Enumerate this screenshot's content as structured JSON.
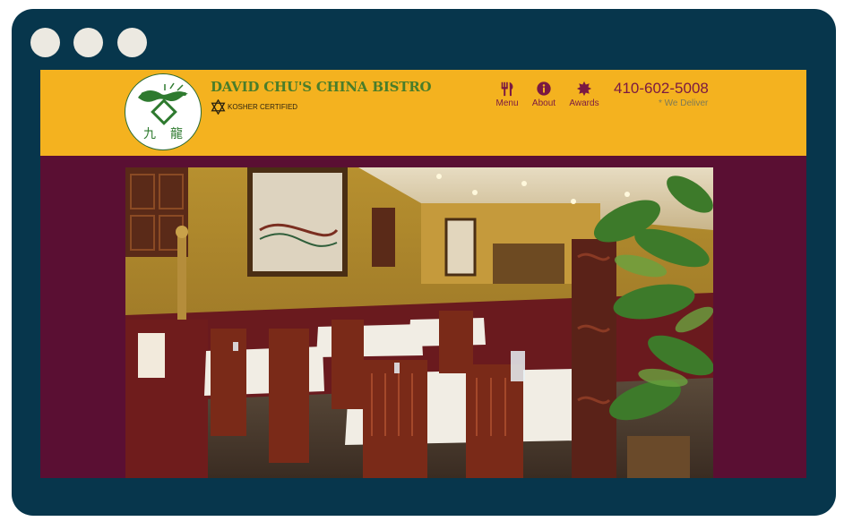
{
  "browser": {
    "controls": [
      "window-dot",
      "window-dot",
      "window-dot"
    ]
  },
  "header": {
    "brand_name": "DAVID CHU'S CHINA BISTRO",
    "kosher_label": "KOSHER CERTIFIED",
    "logo_alt": "Dragon logo with Chinese characters",
    "logo_characters": [
      "九",
      "龍"
    ],
    "nav": [
      {
        "label": "Menu",
        "icon": "utensils-icon"
      },
      {
        "label": "About",
        "icon": "info-icon"
      },
      {
        "label": "Awards",
        "icon": "award-badge-icon"
      }
    ],
    "phone": "410-602-5008",
    "deliver_note": "* We Deliver"
  },
  "hero": {
    "description": "Restaurant dining room interior"
  },
  "colors": {
    "frame": "#07364c",
    "header_bg": "#f4b21f",
    "page_bg": "#5a0f33",
    "brand_green": "#4a7d2a",
    "nav_maroon": "#7a1942"
  }
}
